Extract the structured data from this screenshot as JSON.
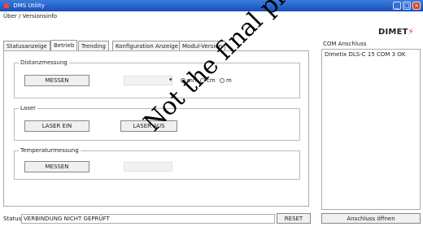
{
  "window": {
    "title": "DMS Utility",
    "controls": [
      "_",
      "□",
      "×"
    ]
  },
  "menu": {
    "label": "Über / Versionsinfo"
  },
  "logo": {
    "text": "DIMET",
    "mark": "⚡"
  },
  "tabs": [
    "Statusanzeige",
    "Betrieb",
    "Trending",
    "Konfiguration Anzeige",
    "Modul-Version"
  ],
  "groups": {
    "distance": {
      "title": "Distanzmessung",
      "button": "MESSEN",
      "dropdown_symbol": "▾",
      "radios": [
        {
          "label": "mm",
          "selected": true
        },
        {
          "label": "cm",
          "selected": false
        },
        {
          "label": "m",
          "selected": false
        }
      ]
    },
    "laser": {
      "title": "Laser",
      "button_on": "LASER EIN",
      "button_off": "LASER AUS"
    },
    "temperature": {
      "title": "Temperaturmessung",
      "button": "MESSEN"
    }
  },
  "comm": {
    "label": "COM Anschluss",
    "value": "Dimetix DLS-C 15 COM 3 OK"
  },
  "status": {
    "label": "Status",
    "value": "VERBINDUNG NICHT GEPRÜFT",
    "reset": "RESET",
    "connect": "Anschluss öffnen"
  },
  "watermark": "Not the final picture"
}
